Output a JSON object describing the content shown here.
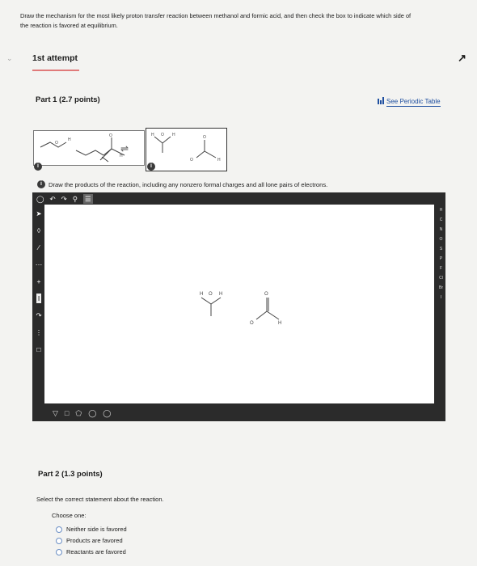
{
  "question": {
    "prompt_line1": "Draw the mechanism for the most likely proton transfer reaction between methanol and formic acid, and then check the box to indicate which side of",
    "prompt_line2": "the reaction is favored at equilibrium."
  },
  "attempt": {
    "title": "1st attempt"
  },
  "part1": {
    "title": "Part 1  (2.7 points)",
    "periodic_link": "See Periodic Table",
    "instruction": "Draw the products of the reaction, including any nonzero formal charges and all lone pairs of electrons."
  },
  "editor": {
    "top_tools": [
      "ring-icon",
      "undo-icon",
      "redo-icon",
      "zoom-icon",
      "template-icon"
    ],
    "left_tools": [
      "arrow-icon",
      "eraser-icon",
      "bond-icon",
      "dash-bond-icon",
      "charge-plus-icon",
      "chain-icon",
      "curved-arrow-icon",
      "lone-pair-icon",
      "bracket-icon"
    ],
    "elements": [
      "H",
      "C",
      "N",
      "O",
      "S",
      "P",
      "F",
      "Cl",
      "Br",
      "I"
    ],
    "bottom_tools": [
      "triangle-icon",
      "square-icon",
      "pentagon-icon",
      "hexagon-icon",
      "heptagon-icon"
    ],
    "molecule_labels": {
      "methanol_h1": "H",
      "methanol_o": "O",
      "methanol_h2": "H",
      "formate_o1": "O",
      "formate_o2": "O",
      "formate_h": "H"
    },
    "scheme_labels": {
      "r_o1": "O",
      "r_h1": "H",
      "r_o2": "O",
      "r_h2": "H",
      "p_h1": "H",
      "p_o1": "O",
      "p_h2": "H",
      "p_o2": "O",
      "p_h3": "H",
      "p_o3": "O"
    },
    "info_badge": "i"
  },
  "part2": {
    "title": "Part 2  (1.3 points)",
    "question": "Select the correct statement about the reaction.",
    "choose_label": "Choose one:",
    "options": [
      "Neither side is favored",
      "Products are favored",
      "Reactants are favored"
    ]
  },
  "colors": {
    "link": "#1f4fa0",
    "editor_frame": "#2b2b2b",
    "underline": "#e07a7a"
  }
}
